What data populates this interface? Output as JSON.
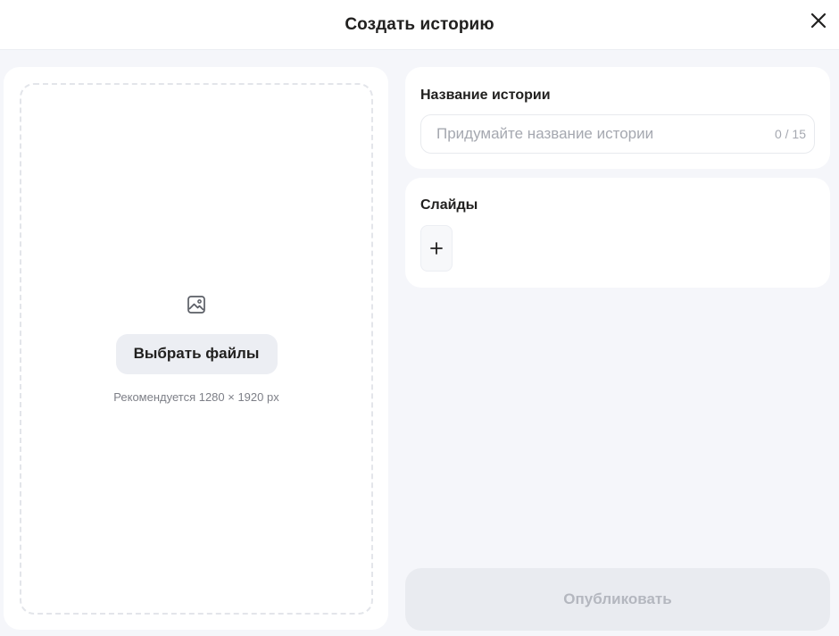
{
  "header": {
    "title": "Создать историю",
    "close_icon": "close-icon"
  },
  "upload": {
    "icon": "image-icon",
    "choose_button_label": "Выбрать файлы",
    "hint": "Рекомендуется 1280 × 1920 px"
  },
  "story_name": {
    "title": "Название истории",
    "input_value": "",
    "input_placeholder": "Придумайте название истории",
    "counter": "0 / 15"
  },
  "slides": {
    "title": "Слайды",
    "add_icon": "plus-icon"
  },
  "publish": {
    "label": "Опубликовать",
    "disabled": true
  },
  "colors": {
    "background": "#f5f6fa",
    "card": "#ffffff",
    "button_secondary": "#eceef3",
    "text_primary": "#21201f",
    "text_muted": "#a5a8b0",
    "publish_disabled_bg": "#e9ebf0",
    "publish_disabled_text": "#b4b7bf"
  }
}
